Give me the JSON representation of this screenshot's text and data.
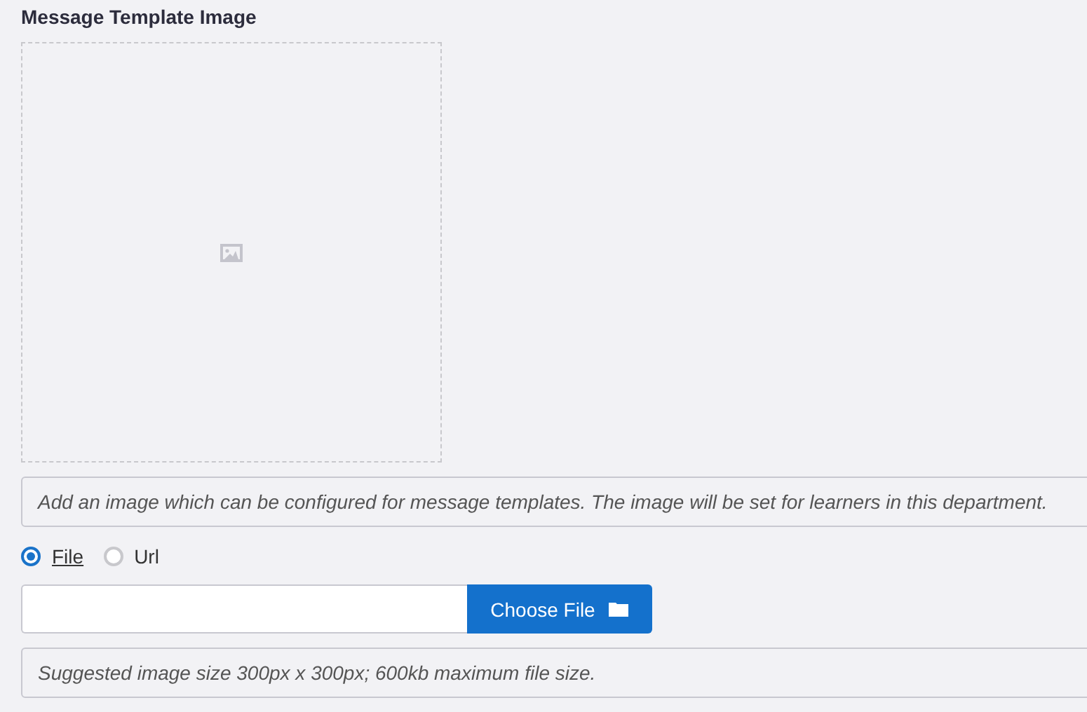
{
  "section": {
    "title": "Message Template Image"
  },
  "description": "Add an image which can be configured for message templates. The image will be set for learners in this department.",
  "source_options": [
    {
      "label": "File",
      "selected": true
    },
    {
      "label": "Url",
      "selected": false
    }
  ],
  "file_field": {
    "button": "Choose File"
  },
  "hint": "Suggested image size 300px x 300px; 600kb maximum file size."
}
